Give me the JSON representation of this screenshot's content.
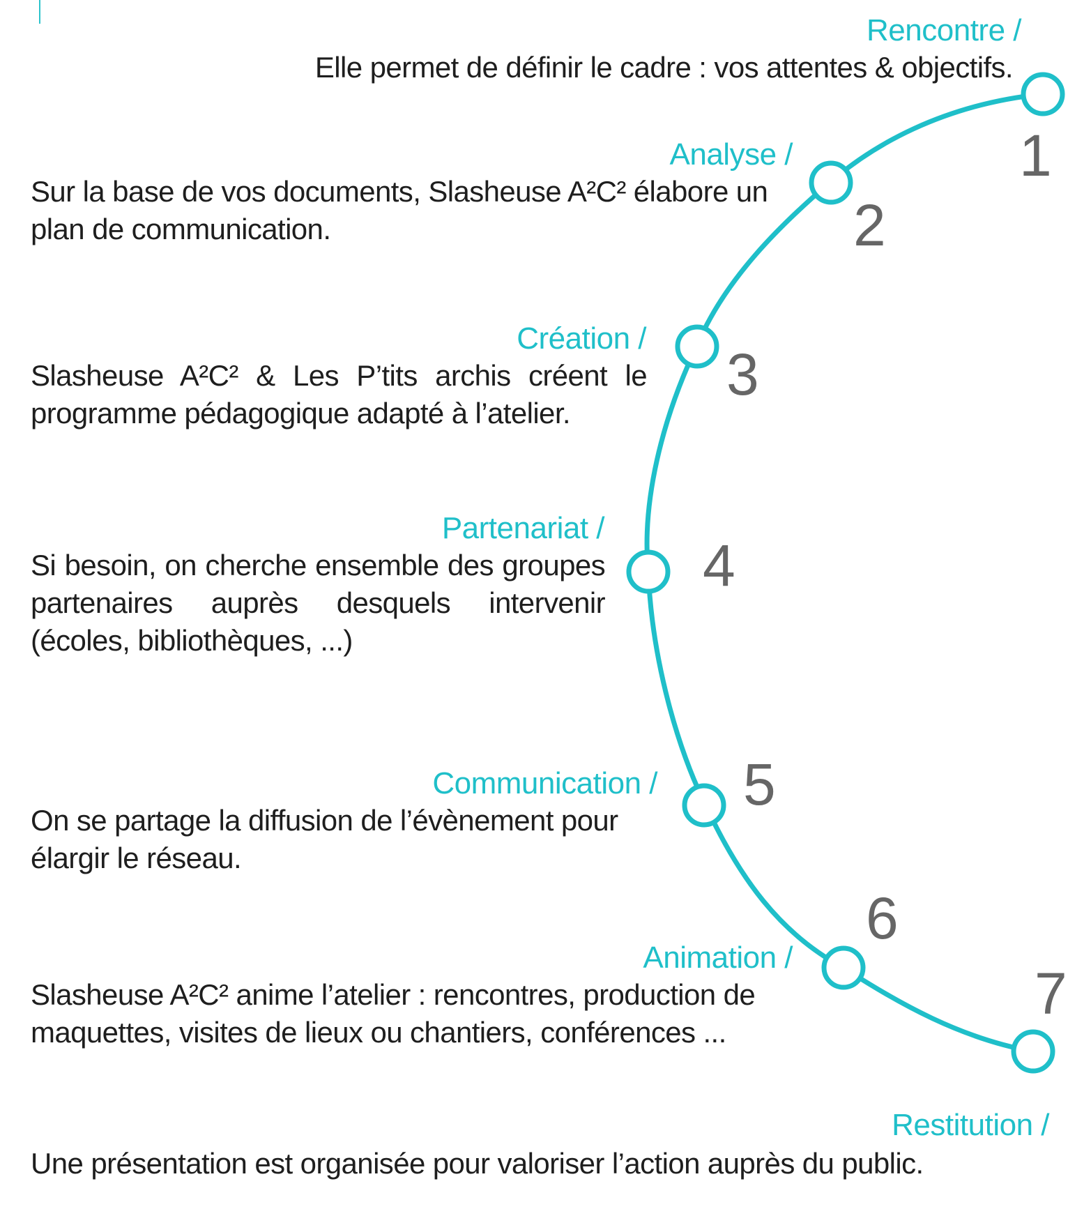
{
  "colors": {
    "accent": "#1fbfc9",
    "text": "#1e1e1e",
    "number": "#666666"
  },
  "steps": [
    {
      "number": "1",
      "title": "Rencontre /",
      "text": "Elle permet de définir le cadre : vos attentes & objectifs."
    },
    {
      "number": "2",
      "title": "Analyse /",
      "text": "Sur la base de vos documents, Slasheuse A²C² élabore un plan de communication."
    },
    {
      "number": "3",
      "title": "Création /",
      "text": "Slasheuse A²C² & Les P’tits archis créent le programme pédagogique adapté à l’atelier."
    },
    {
      "number": "4",
      "title": "Partenariat /",
      "text": "Si besoin, on cherche ensemble des groupes partenaires auprès desquels intervenir (écoles, bibliothèques, ...)"
    },
    {
      "number": "5",
      "title": "Communication /",
      "text": "On se partage la diffusion de l’évènement pour élargir le réseau."
    },
    {
      "number": "6",
      "title": "Animation /",
      "text": "Slasheuse A²C² anime l’atelier : rencontres, production de maquettes, visites de lieux ou chantiers, conférences ..."
    },
    {
      "number": "7",
      "title": "Restitution /",
      "text": "Une présentation est organisée pour valoriser l’action auprès du public."
    }
  ]
}
